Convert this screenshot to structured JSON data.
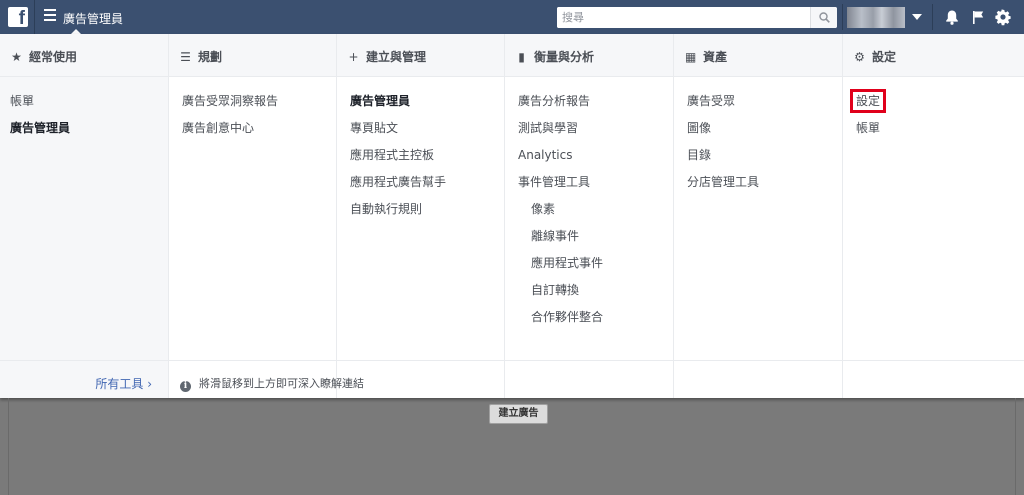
{
  "topbar": {
    "logo_letter": "f",
    "app_title": "廣告管理員",
    "search_placeholder": "搜尋",
    "icons": [
      "facebook-logo",
      "menu-icon",
      "search-icon",
      "bell-icon",
      "flag-icon",
      "gear-icon"
    ],
    "colors": {
      "bar": "#3b5070"
    }
  },
  "columns": [
    {
      "header": "經常使用",
      "header_icon": "★",
      "items": [
        {
          "label": "帳單",
          "bold": false
        },
        {
          "label": "廣告管理員",
          "bold": true
        }
      ]
    },
    {
      "header": "規劃",
      "header_icon": "☰",
      "items": [
        {
          "label": "廣告受眾洞察報告"
        },
        {
          "label": "廣告創意中心"
        }
      ]
    },
    {
      "header": "建立與管理",
      "header_icon": "+",
      "items": [
        {
          "label": "廣告管理員",
          "bold": true
        },
        {
          "label": "專頁貼文"
        },
        {
          "label": "應用程式主控板"
        },
        {
          "label": "應用程式廣告幫手"
        },
        {
          "label": "自動執行規則"
        }
      ]
    },
    {
      "header": "衡量與分析",
      "header_icon": "▮",
      "items": [
        {
          "label": "廣告分析報告"
        },
        {
          "label": "測試與學習"
        },
        {
          "label": "Analytics"
        },
        {
          "label": "事件管理工具"
        },
        {
          "label": "像素",
          "sub": true
        },
        {
          "label": "離線事件",
          "sub": true
        },
        {
          "label": "應用程式事件",
          "sub": true
        },
        {
          "label": "自訂轉換",
          "sub": true
        },
        {
          "label": "合作夥伴整合",
          "sub": true
        }
      ]
    },
    {
      "header": "資產",
      "header_icon": "▦",
      "items": [
        {
          "label": "廣告受眾"
        },
        {
          "label": "圖像"
        },
        {
          "label": "目錄"
        },
        {
          "label": "分店管理工具"
        }
      ]
    },
    {
      "header": "設定",
      "header_icon": "⚙",
      "items": [
        {
          "label": "設定",
          "highlight": true
        },
        {
          "label": "帳單"
        }
      ]
    }
  ],
  "footer": {
    "all_tools": "所有工具",
    "all_tools_arrow": "›",
    "hint": "將滑鼠移到上方即可深入瞭解連結"
  },
  "background": {
    "create_ad_button": "建立廣告"
  },
  "highlight_color": "#e0001b"
}
